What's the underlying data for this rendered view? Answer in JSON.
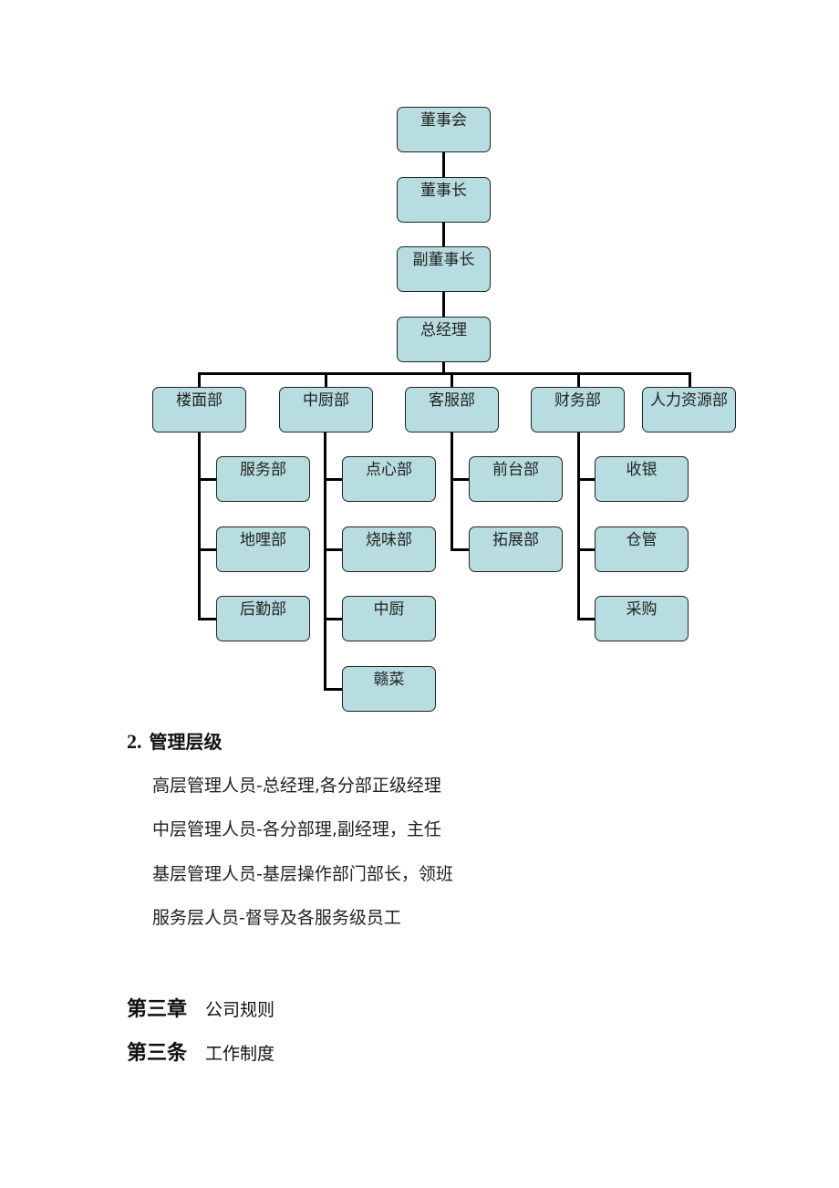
{
  "org_chart": {
    "top_chain": [
      "董事会",
      "董事长",
      "副董事长",
      "总经理"
    ],
    "departments": [
      {
        "name": "楼面部",
        "children": [
          "服务部",
          "地哩部",
          "后勤部"
        ]
      },
      {
        "name": "中厨部",
        "children": [
          "点心部",
          "烧味部",
          "中厨",
          "赣菜"
        ]
      },
      {
        "name": "客服部",
        "children": [
          "前台部",
          "拓展部"
        ]
      },
      {
        "name": "财务部",
        "children": [
          "收银",
          "仓管",
          "采购"
        ]
      },
      {
        "name": "人力资源部",
        "children": []
      }
    ],
    "colors": {
      "box_fill": "#b8dde0",
      "line": "#000000"
    }
  },
  "section": {
    "number": "2.",
    "title": "管理层级",
    "lines": [
      "高层管理人员-总经理,各分部正级经理",
      "中层管理人员-各分部理,副经理，主任",
      "基层管理人员-基层操作部门部长，领班",
      "服务层人员-督导及各服务级员工"
    ]
  },
  "chapter": {
    "label": "第三章",
    "title": "公司规则"
  },
  "article": {
    "label": "第三条",
    "title": "工作制度"
  }
}
